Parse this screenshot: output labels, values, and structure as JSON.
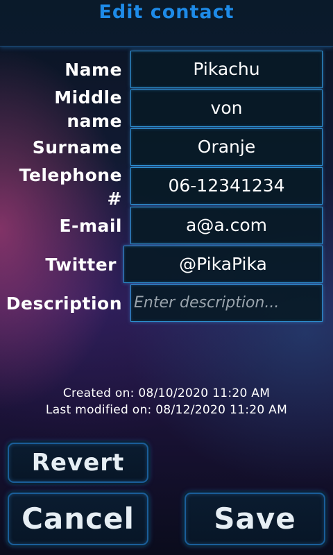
{
  "header": {
    "title": "Edit contact"
  },
  "form": {
    "name": {
      "label": "Name",
      "value": "Pikachu"
    },
    "middle_name": {
      "label_line1": "Middle",
      "label_line2": "name",
      "value": "von"
    },
    "surname": {
      "label": "Surname",
      "value": "Oranje"
    },
    "telephone": {
      "label_line1": "Telephone",
      "label_line2": "#",
      "value": "06-12341234"
    },
    "email": {
      "label": "E-mail",
      "value": "a@a.com"
    },
    "twitter": {
      "label": "Twitter",
      "value": "@PikaPika"
    },
    "description": {
      "label": "Description",
      "value": "",
      "placeholder": "Enter description..."
    }
  },
  "meta": {
    "created": "Created on: 08/10/2020 11:20 AM",
    "modified": "Last modified on: 08/12/2020 11:20 AM"
  },
  "buttons": {
    "revert": "Revert",
    "cancel": "Cancel",
    "save": "Save"
  },
  "colors": {
    "title": "#1e8be8",
    "field_border": "#2d8fd0",
    "button_border": "#1a5e9a"
  }
}
